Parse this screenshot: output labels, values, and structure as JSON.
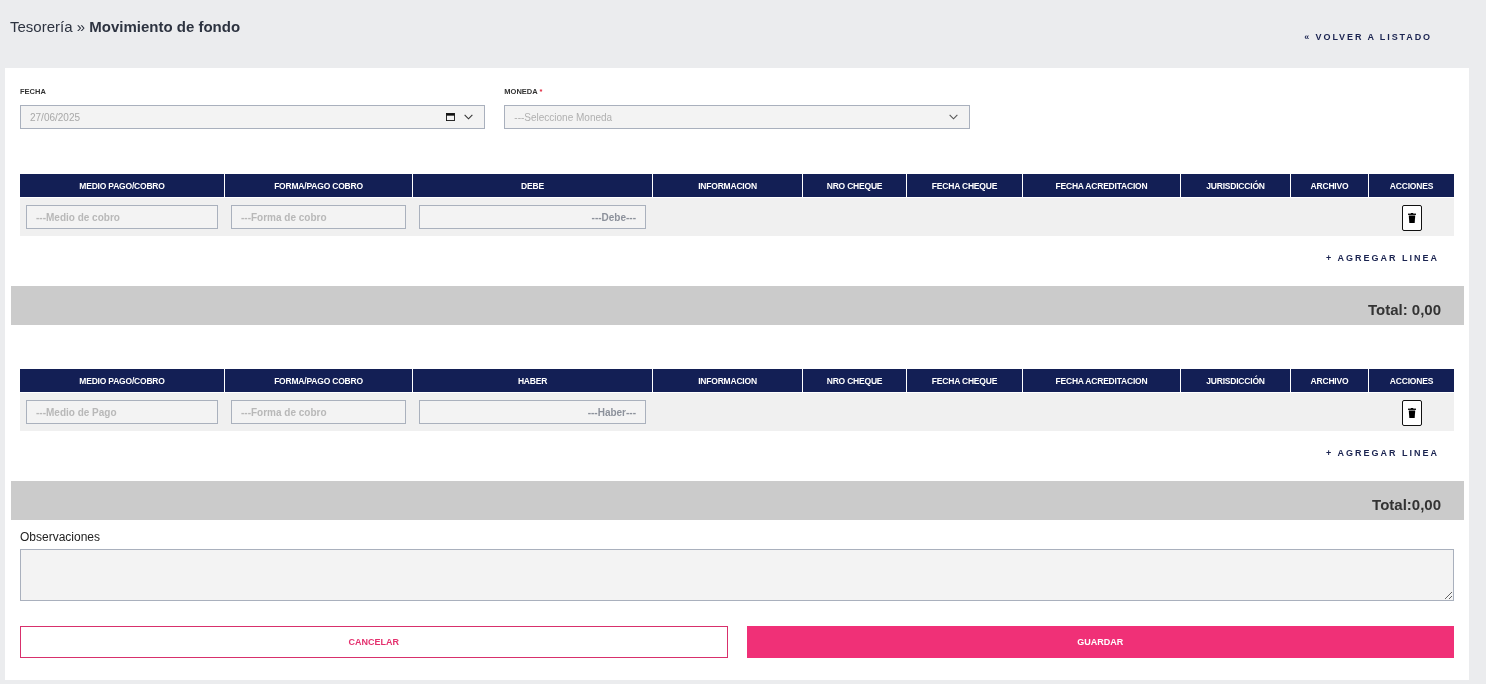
{
  "breadcrumb": "Tesorería » **Movimiento de fondo**",
  "back_link": "« VOLVER A LISTADO",
  "fields": [
    {
      "kind": "date",
      "label": "FECHA",
      "value": "27/06/2025"
    },
    {
      "kind": "select",
      "label": "MONEDA",
      "required_mark": "*",
      "placeholder": "---Seleccione Moneda"
    }
  ],
  "tables": [
    {
      "columns": [
        "MEDIO PAGO/COBRO",
        "FORMA/PAGO COBRO",
        "DEBE",
        "INFORMACION",
        "NRO CHEQUE",
        "FECHA CHEQUE",
        "FECHA ACREDITACION",
        "JURISDICCIÓN",
        "ARCHIVO",
        "ACCIONES"
      ],
      "rows": [
        {
          "inputs": [
            {
              "kind": "text",
              "placeholder": "---Medio de cobro"
            },
            {
              "kind": "text",
              "placeholder": "---Forma de cobro"
            },
            {
              "kind": "amount",
              "placeholder": "---Debe---"
            }
          ],
          "deletable": true
        }
      ],
      "add_line": "+ AGREGAR LINEA",
      "total": "Total: 0,00"
    },
    {
      "columns": [
        "MEDIO PAGO/COBRO",
        "FORMA/PAGO COBRO",
        "HABER",
        "INFORMACION",
        "NRO CHEQUE",
        "FECHA CHEQUE",
        "FECHA ACREDITACION",
        "JURISDICCIÓN",
        "ARCHIVO",
        "ACCIONES"
      ],
      "rows": [
        {
          "inputs": [
            {
              "kind": "text",
              "placeholder": "---Medio de Pago"
            },
            {
              "kind": "text",
              "placeholder": "---Forma de cobro"
            },
            {
              "kind": "amount",
              "placeholder": "---Haber---"
            }
          ],
          "deletable": true
        }
      ],
      "add_line": "+ AGREGAR LINEA",
      "total": "Total:0,00"
    }
  ],
  "notes": {
    "label": "Observaciones"
  },
  "buttons": [
    {
      "kind": "secondary",
      "label": "CANCELAR"
    },
    {
      "kind": "primary",
      "label": "GUARDAR"
    }
  ]
}
